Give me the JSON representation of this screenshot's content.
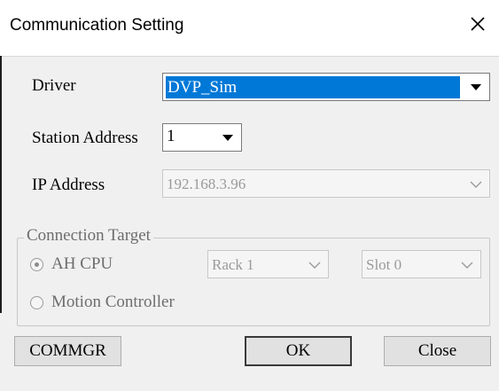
{
  "window": {
    "title": "Communication Setting",
    "close_label": "×"
  },
  "form": {
    "driver_label": "Driver",
    "driver_value": "DVP_Sim",
    "station_label": "Station Address",
    "station_value": "1",
    "ip_label": "IP Address",
    "ip_value": "192.168.3.96"
  },
  "connection_target": {
    "title": "Connection Target",
    "ah_cpu_label": "AH CPU",
    "rack_value": "Rack 1",
    "slot_value": "Slot 0",
    "motion_label": "Motion Controller",
    "selected": "AH CPU"
  },
  "buttons": {
    "commgr": "COMMGR",
    "ok": "OK",
    "close": "Close"
  }
}
